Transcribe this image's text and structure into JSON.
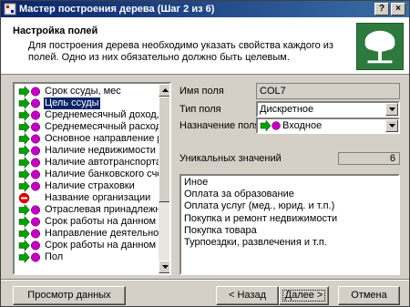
{
  "window": {
    "title": "Мастер построения дерева (Шаг 2 из 6)",
    "help_label": "?",
    "close_label": "×"
  },
  "header": {
    "title": "Настройка полей",
    "description": "Для построения дерева необходимо указать свойства каждого из полей. Одно из них обязательно должно быть целевым."
  },
  "fields_tree": {
    "items": [
      {
        "label": "Срок ссуды, мес",
        "icon": "input-field-icon",
        "selected": false
      },
      {
        "label": "Цель ссуды",
        "icon": "input-field-icon",
        "selected": true
      },
      {
        "label": "Среднемесячный доход, руб",
        "icon": "input-field-icon",
        "selected": false
      },
      {
        "label": "Среднемесячный расход, руб",
        "icon": "input-field-icon",
        "selected": false
      },
      {
        "label": "Основное направление расход",
        "icon": "input-field-icon",
        "selected": false
      },
      {
        "label": "Наличие недвижимости",
        "icon": "input-field-icon",
        "selected": false
      },
      {
        "label": "Наличие автотранспорта",
        "icon": "input-field-icon",
        "selected": false
      },
      {
        "label": "Наличие банковского счета",
        "icon": "input-field-icon",
        "selected": false
      },
      {
        "label": "Наличие страховки",
        "icon": "input-field-icon",
        "selected": false
      },
      {
        "label": "Название организации",
        "icon": "unused-field-icon",
        "selected": false
      },
      {
        "label": "Отраслевая принадлежность",
        "icon": "input-field-icon",
        "selected": false
      },
      {
        "label": "Срок работы на данном пред",
        "icon": "input-field-icon",
        "selected": false
      },
      {
        "label": "Направление деятельности",
        "icon": "input-field-icon",
        "selected": false
      },
      {
        "label": "Срок работы на данном напр",
        "icon": "input-field-icon",
        "selected": false
      },
      {
        "label": "Пол",
        "icon": "input-field-icon",
        "selected": false
      }
    ]
  },
  "properties": {
    "field_name_label": "Имя поля",
    "field_name_value": "COL7",
    "field_type_label": "Тип поля",
    "field_type_value": "Дискретное",
    "field_purpose_label": "Назначение поля",
    "field_purpose_value": "Входное",
    "unique_label": "Уникальных значений",
    "unique_count": "6"
  },
  "unique_values": [
    "Иное",
    "Оплата за образование",
    "Оплата услуг (мед., юрид. и т.п.)",
    "Покупка и ремонт недвижимости",
    "Покупка товара",
    "Турпоездки, развлечения и т.п."
  ],
  "buttons": {
    "preview": "Просмотр данных",
    "back": "< Назад",
    "next": "Далее >",
    "cancel": "Отмена"
  },
  "colors": {
    "title_bar": "#0a246a",
    "selection": "#0a246a",
    "icon_arrow": "#00a000",
    "icon_ball": "#c000c0",
    "icon_unused": "#e00000"
  }
}
